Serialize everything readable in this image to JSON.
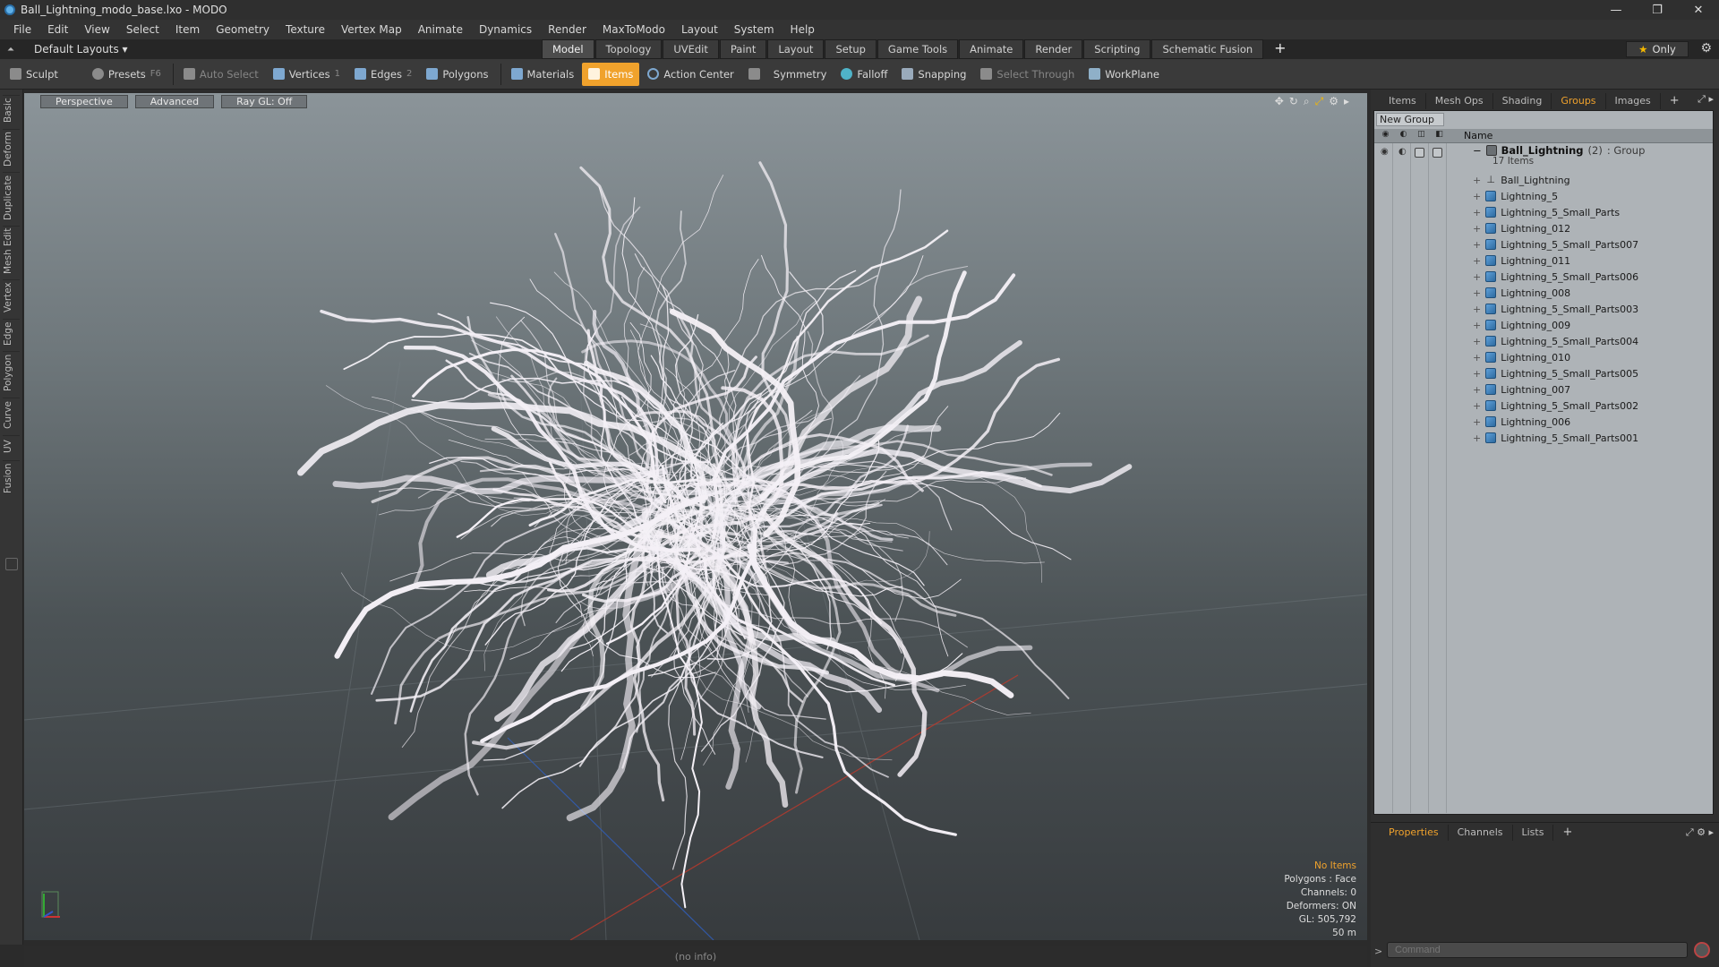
{
  "window": {
    "title": "Ball_Lightning_modo_base.lxo - MODO",
    "controls": [
      "—",
      "❐",
      "✕"
    ]
  },
  "menu": [
    "File",
    "Edit",
    "View",
    "Select",
    "Item",
    "Geometry",
    "Texture",
    "Vertex Map",
    "Animate",
    "Dynamics",
    "Render",
    "MaxToModo",
    "Layout",
    "System",
    "Help"
  ],
  "layout_bar": {
    "layout_name": "Default Layouts ▾",
    "tabs": [
      "Model",
      "Topology",
      "UVEdit",
      "Paint",
      "Layout",
      "Setup",
      "Game Tools",
      "Animate",
      "Render",
      "Scripting",
      "Schematic Fusion"
    ],
    "active_tab": "Model",
    "add_tab": "+",
    "only_label": "Only"
  },
  "toolbar": {
    "sculpt": "Sculpt",
    "presets": "Presets",
    "presets_key": "F6",
    "auto_select": "Auto Select",
    "vertices": "Vertices",
    "vertices_key": "1",
    "edges": "Edges",
    "edges_key": "2",
    "polygons": "Polygons",
    "materials": "Materials",
    "items": "Items",
    "action_center": "Action Center",
    "symmetry": "Symmetry",
    "falloff": "Falloff",
    "snapping": "Snapping",
    "select_through": "Select Through",
    "workplane": "WorkPlane"
  },
  "left_tabs": [
    "Basic",
    "Deform",
    "Duplicate",
    "Mesh Edit",
    "Vertex",
    "Edge",
    "Polygon",
    "Curve",
    "UV",
    "Fusion"
  ],
  "viewport": {
    "buttons": [
      "Perspective",
      "Advanced",
      "Ray GL: Off"
    ],
    "stats": {
      "selection": "No Items",
      "polygons": "Polygons : Face",
      "channels": "Channels: 0",
      "deformers": "Deformers: ON",
      "gl": "GL: 505,792",
      "scale": "50 m"
    }
  },
  "status": {
    "info": "(no info)"
  },
  "right_panel": {
    "tabs": [
      "Items",
      "Mesh Ops",
      "Shading",
      "Groups",
      "Images"
    ],
    "active_tab": "Groups",
    "new_group": "New Group",
    "column_name": "Name",
    "group": {
      "name": "Ball_Lightning",
      "count": "(2)",
      "type": ": Group",
      "sub": "17 Items"
    },
    "items": [
      {
        "name": "Ball_Lightning",
        "kind": "locator"
      },
      {
        "name": "Lightning_5",
        "kind": "mesh"
      },
      {
        "name": "Lightning_5_Small_Parts",
        "kind": "mesh"
      },
      {
        "name": "Lightning_012",
        "kind": "mesh"
      },
      {
        "name": "Lightning_5_Small_Parts007",
        "kind": "mesh"
      },
      {
        "name": "Lightning_011",
        "kind": "mesh"
      },
      {
        "name": "Lightning_5_Small_Parts006",
        "kind": "mesh"
      },
      {
        "name": "Lightning_008",
        "kind": "mesh"
      },
      {
        "name": "Lightning_5_Small_Parts003",
        "kind": "mesh"
      },
      {
        "name": "Lightning_009",
        "kind": "mesh"
      },
      {
        "name": "Lightning_5_Small_Parts004",
        "kind": "mesh"
      },
      {
        "name": "Lightning_010",
        "kind": "mesh"
      },
      {
        "name": "Lightning_5_Small_Parts005",
        "kind": "mesh"
      },
      {
        "name": "Lightning_007",
        "kind": "mesh"
      },
      {
        "name": "Lightning_5_Small_Parts002",
        "kind": "mesh"
      },
      {
        "name": "Lightning_006",
        "kind": "mesh"
      },
      {
        "name": "Lightning_5_Small_Parts001",
        "kind": "mesh"
      }
    ],
    "bottom_tabs": [
      "Properties",
      "Channels",
      "Lists"
    ],
    "bottom_active": "Properties",
    "command_placeholder": "Command"
  },
  "colors": {
    "accent": "#f0a22c",
    "viewport_top": "#8b9499",
    "viewport_bottom": "#373b3e",
    "lightning": "#f4f0f6"
  }
}
